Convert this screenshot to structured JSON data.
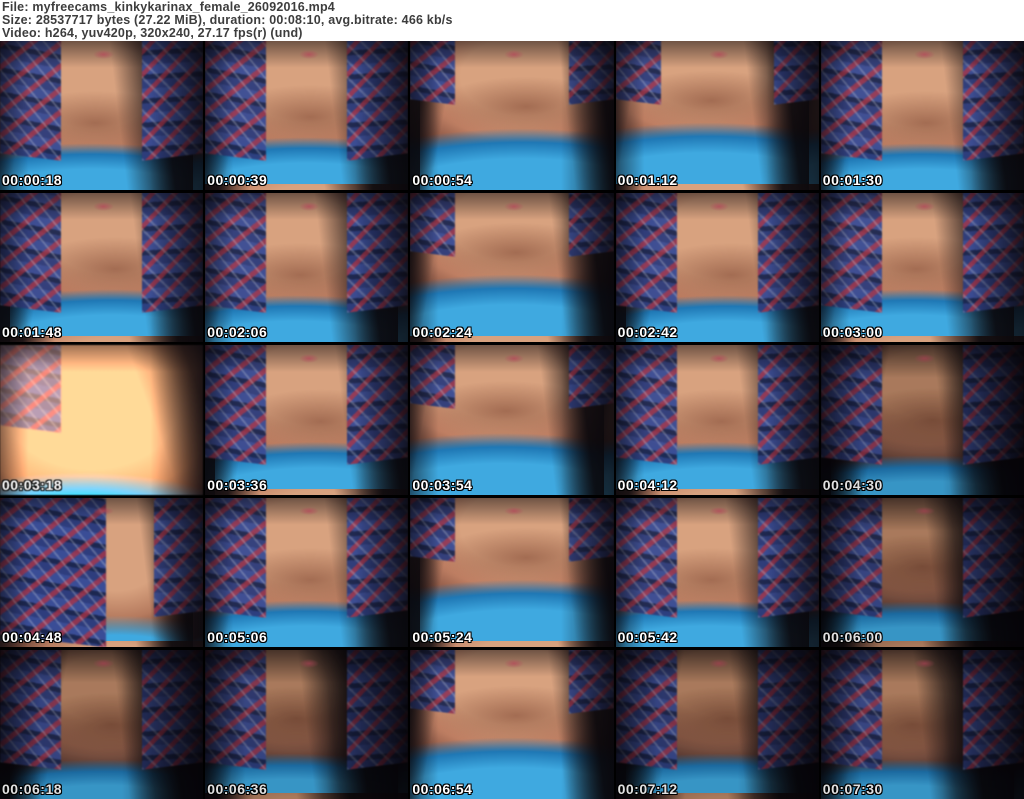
{
  "header": {
    "lines": [
      "File: myfreecams_kinkykarinax_female_26092016.mp4",
      "Size: 28537717 bytes (27.22 MiB), duration: 00:08:10, avg.bitrate: 466 kb/s",
      "Video: h264, yuv420p, 320x240, 27.17 fps(r) (und)"
    ]
  },
  "grid": {
    "columns": 5,
    "rows": 5,
    "thumbnails": [
      {
        "timestamp": "00:00:18",
        "variant": "standard"
      },
      {
        "timestamp": "00:00:39",
        "variant": "standard"
      },
      {
        "timestamp": "00:00:54",
        "variant": "blueheavy"
      },
      {
        "timestamp": "00:01:12",
        "variant": "blueheavy"
      },
      {
        "timestamp": "00:01:30",
        "variant": "standard"
      },
      {
        "timestamp": "00:01:48",
        "variant": "standard"
      },
      {
        "timestamp": "00:02:06",
        "variant": "standard"
      },
      {
        "timestamp": "00:02:24",
        "variant": "blueheavy"
      },
      {
        "timestamp": "00:02:42",
        "variant": "standard"
      },
      {
        "timestamp": "00:03:00",
        "variant": "standard"
      },
      {
        "timestamp": "00:03:18",
        "variant": "bright"
      },
      {
        "timestamp": "00:03:36",
        "variant": "standard"
      },
      {
        "timestamp": "00:03:54",
        "variant": "blueheavy"
      },
      {
        "timestamp": "00:04:12",
        "variant": "standard"
      },
      {
        "timestamp": "00:04:30",
        "variant": "dark"
      },
      {
        "timestamp": "00:04:48",
        "variant": "plaid"
      },
      {
        "timestamp": "00:05:06",
        "variant": "standard"
      },
      {
        "timestamp": "00:05:24",
        "variant": "blueheavy"
      },
      {
        "timestamp": "00:05:42",
        "variant": "standard"
      },
      {
        "timestamp": "00:06:00",
        "variant": "dark"
      },
      {
        "timestamp": "00:06:18",
        "variant": "dark"
      },
      {
        "timestamp": "00:06:36",
        "variant": "dark"
      },
      {
        "timestamp": "00:06:54",
        "variant": "blueheavy"
      },
      {
        "timestamp": "00:07:12",
        "variant": "dark"
      },
      {
        "timestamp": "00:07:30",
        "variant": "dark"
      }
    ]
  },
  "colors": {
    "header_bg": "#ffffff",
    "header_text": "#3d3d3d",
    "timestamp_text": "#ffffff",
    "timestamp_outline": "#000000",
    "grid_bg": "#000000",
    "lace_blue": "#3fa9e0",
    "lace_blue_deep": "#1f78b5",
    "skin": "#d8a27f",
    "plaid_navy": "#2e3d7d",
    "plaid_red": "#b13343",
    "hair_dark": "#0d0a0e"
  }
}
